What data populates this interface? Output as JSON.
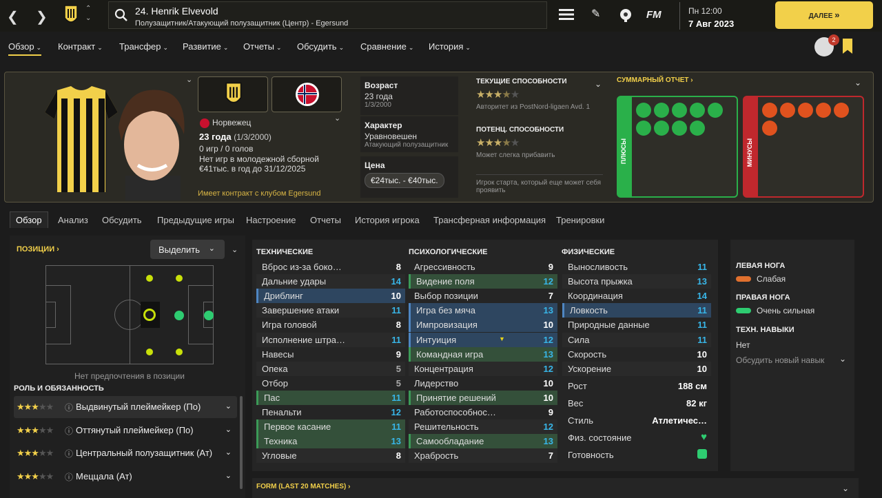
{
  "topbar": {
    "player_name": "24. Henrik Elvevold",
    "player_position": "Полузащитник/Атакующий полузащитник (Центр) - Egersund",
    "day_time": "Пн 12:00",
    "date": "7 Авг 2023",
    "continue_label": "ДАЛЕЕ",
    "fm_logo": "FM"
  },
  "menu": {
    "items": [
      "Обзор",
      "Контракт",
      "Трансфер",
      "Развитие",
      "Отчеты",
      "Обсудить",
      "Сравнение",
      "История"
    ],
    "notifications": "2"
  },
  "profile": {
    "nationality": "Норвежец",
    "age_line": "23 года",
    "age_dob": "(1/3/2000)",
    "games": "0 игр / 0 голов",
    "youth": "Нет игр в молодежной сборной",
    "wage": "€41тыс. в год до 31/12/2025",
    "contract_note": "Имеет контракт с клубом Egersund",
    "age_label": "Возраст",
    "age_value": "23 года",
    "age_date": "1/3/2000",
    "character_label": "Характер",
    "character_value": "Уравновешен",
    "character_role": "Атакующий полузащитник",
    "price_label": "Цена",
    "price_value": "€24тыс. - €40тыс.",
    "current_ability_label": "ТЕКУЩИЕ СПОСОБНОСТИ",
    "current_ability_stars": 3.5,
    "current_ability_note": "Авторитет из PostNord-ligaen Avd. 1",
    "potential_ability_label": "ПОТЕНЦ. СПОСОБНОСТИ",
    "potential_ability_stars": 3.5,
    "potential_ability_note": "Может слегка прибавить",
    "starter_note": "Игрок старта, который еще может себя проявить",
    "summary_title": "СУММАРНЫЙ ОТЧЕТ",
    "plus_label": "ПЛЮСЫ",
    "minus_label": "МИНУСЫ"
  },
  "tabs": [
    "Обзор",
    "Анализ",
    "Обсудить",
    "Предыдущие игры",
    "Настроение",
    "Отчеты",
    "История игрока",
    "Трансферная информация",
    "Тренировки"
  ],
  "positions": {
    "title": "ПОЗИЦИИ",
    "highlight_label": "Выделить",
    "no_pref": "Нет предпочтения в позиции",
    "roles_title": "РОЛЬ И ОБЯЗАННОСТЬ",
    "roles": [
      {
        "name": "Выдвинутый плеймейкер (По)",
        "stars": 3
      },
      {
        "name": "Оттянутый плеймейкер (По)",
        "stars": 3
      },
      {
        "name": "Центральный полузащитник (Ат)",
        "stars": 3
      },
      {
        "name": "Меццала (Ат)",
        "stars": 3
      }
    ]
  },
  "attributes": {
    "technical_title": "ТЕХНИЧЕСКИЕ",
    "mental_title": "ПСИХОЛОГИЧЕСКИЕ",
    "physical_title": "ФИЗИЧЕСКИЕ",
    "technical": [
      {
        "name": "Вброс из-за боко…",
        "value": "8"
      },
      {
        "name": "Дальние удары",
        "value": "14"
      },
      {
        "name": "Дриблинг",
        "value": "10"
      },
      {
        "name": "Завершение атаки",
        "value": "11"
      },
      {
        "name": "Игра головой",
        "value": "8"
      },
      {
        "name": "Исполнение штра…",
        "value": "11"
      },
      {
        "name": "Навесы",
        "value": "9"
      },
      {
        "name": "Опека",
        "value": "5"
      },
      {
        "name": "Отбор",
        "value": "5"
      },
      {
        "name": "Пас",
        "value": "11"
      },
      {
        "name": "Пенальти",
        "value": "12"
      },
      {
        "name": "Первое касание",
        "value": "11"
      },
      {
        "name": "Техника",
        "value": "13"
      },
      {
        "name": "Угловые",
        "value": "8"
      }
    ],
    "mental": [
      {
        "name": "Агрессивность",
        "value": "9"
      },
      {
        "name": "Видение поля",
        "value": "12"
      },
      {
        "name": "Выбор позиции",
        "value": "7"
      },
      {
        "name": "Игра без мяча",
        "value": "13"
      },
      {
        "name": "Импровизация",
        "value": "10"
      },
      {
        "name": "Интуиция",
        "value": "12"
      },
      {
        "name": "Командная игра",
        "value": "13"
      },
      {
        "name": "Концентрация",
        "value": "12"
      },
      {
        "name": "Лидерство",
        "value": "10"
      },
      {
        "name": "Принятие решений",
        "value": "10"
      },
      {
        "name": "Работоспособнос…",
        "value": "9"
      },
      {
        "name": "Решительность",
        "value": "12"
      },
      {
        "name": "Самообладание",
        "value": "13"
      },
      {
        "name": "Храбрость",
        "value": "7"
      }
    ],
    "physical": [
      {
        "name": "Выносливость",
        "value": "11"
      },
      {
        "name": "Высота прыжка",
        "value": "13"
      },
      {
        "name": "Координация",
        "value": "14"
      },
      {
        "name": "Ловкость",
        "value": "11"
      },
      {
        "name": "Природные данные",
        "value": "11"
      },
      {
        "name": "Сила",
        "value": "11"
      },
      {
        "name": "Скорость",
        "value": "10"
      },
      {
        "name": "Ускорение",
        "value": "10"
      }
    ],
    "height_label": "Рост",
    "height": "188 см",
    "weight_label": "Вес",
    "weight": "82 кг",
    "style_label": "Стиль",
    "style": "Атлетичес…",
    "condition_label": "Физ. состояние",
    "readiness_label": "Готовность"
  },
  "feet": {
    "left_label": "ЛЕВАЯ НОГА",
    "left_value": "Слабая",
    "right_label": "ПРАВАЯ НОГА",
    "right_value": "Очень сильная",
    "skills_label": "ТЕХН. НАВЫКИ",
    "skills_value": "Нет",
    "discuss_skill": "Обсудить новый навык"
  },
  "form_title": "FORM (LAST 20 MATCHES)",
  "colors": {
    "accent": "#f2d04a",
    "plus": "#2ab04a",
    "minus": "#c0282d",
    "blue": "#38b6e8"
  }
}
